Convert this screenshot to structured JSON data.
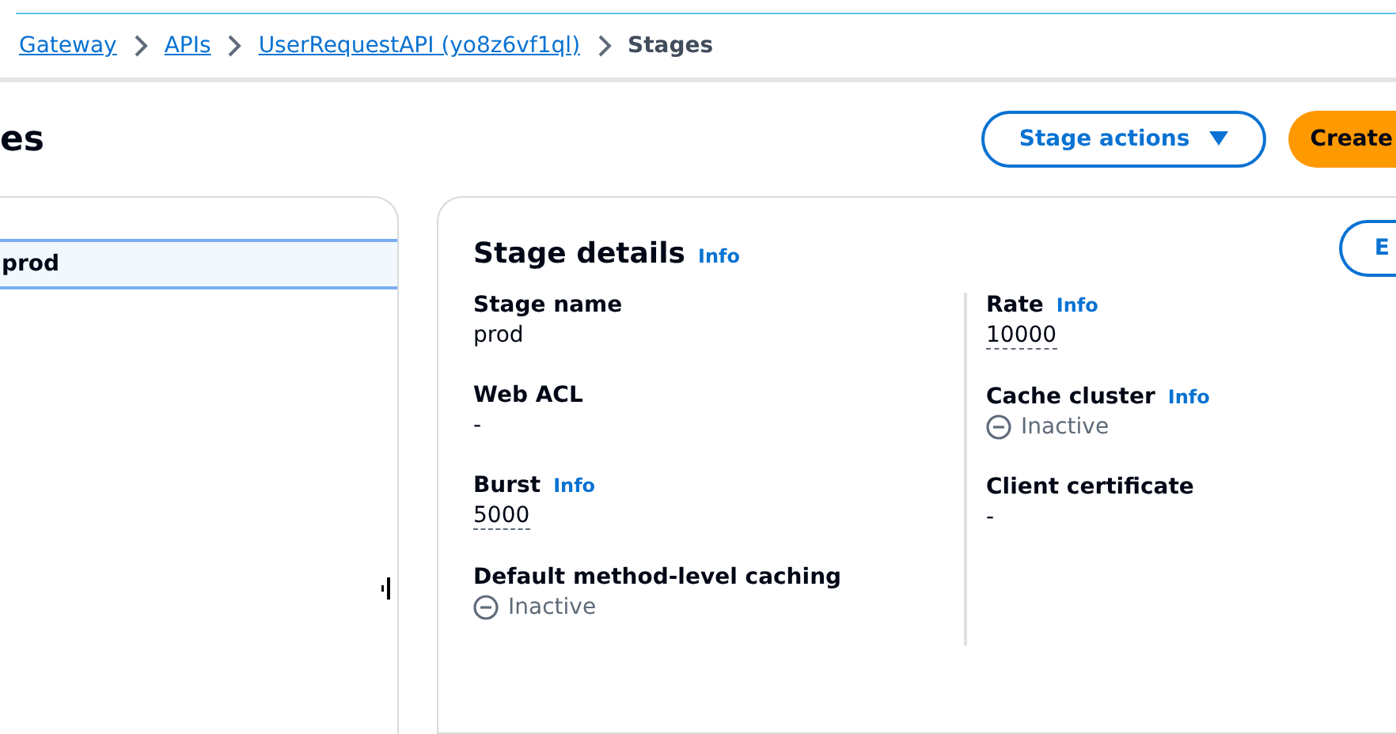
{
  "breadcrumbs": [
    {
      "label": "Gateway",
      "link": true
    },
    {
      "label": "APIs",
      "link": true
    },
    {
      "label": "UserRequestAPI (yo8z6vf1ql)",
      "link": true
    },
    {
      "label": "Stages",
      "link": false
    }
  ],
  "page_title": "es",
  "actions": [
    {
      "label": "Stage actions",
      "kind": "dropdown"
    },
    {
      "label": "Create",
      "kind": "primary"
    }
  ],
  "stage_tree": [
    {
      "label": "prod",
      "selected": true
    }
  ],
  "details": {
    "title": "Stage details",
    "info": "Info",
    "edit_button": "E",
    "columns": [
      [
        {
          "label": "Stage name",
          "value": "prod",
          "kind": "plain"
        },
        {
          "label": "Web ACL",
          "value": "-",
          "kind": "plain"
        },
        {
          "label": "Burst",
          "info": "Info",
          "value": "5000",
          "kind": "popover"
        },
        {
          "label": "Default method-level caching",
          "value": "Inactive",
          "kind": "status"
        }
      ],
      [
        {
          "label": "Rate",
          "info": "Info",
          "value": "10000",
          "kind": "popover"
        },
        {
          "label": "Cache cluster",
          "info": "Info",
          "value": "Inactive",
          "kind": "status"
        },
        {
          "label": "Client certificate",
          "value": "-",
          "kind": "plain"
        }
      ]
    ]
  }
}
